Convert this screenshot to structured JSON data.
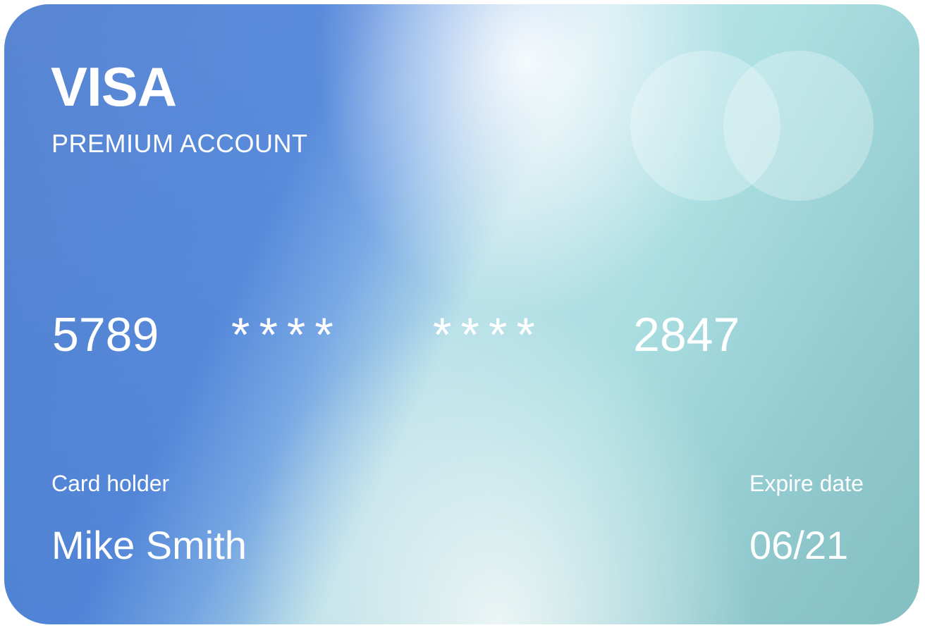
{
  "card": {
    "brand": "VISA",
    "account_type": "PREMIUM ACCOUNT",
    "number_groups": [
      "5789",
      "****",
      "****",
      "2847"
    ],
    "holder_label": "Card holder",
    "holder_name": "Mike Smith",
    "expire_label": "Expire date",
    "expire_value": "06/21",
    "logo_icon": "circles-logo-icon",
    "colors": {
      "primary_blue": "#5387db",
      "light_cyan": "#b8e2ea",
      "teal": "#86c2c4",
      "text": "#ffffff"
    }
  }
}
